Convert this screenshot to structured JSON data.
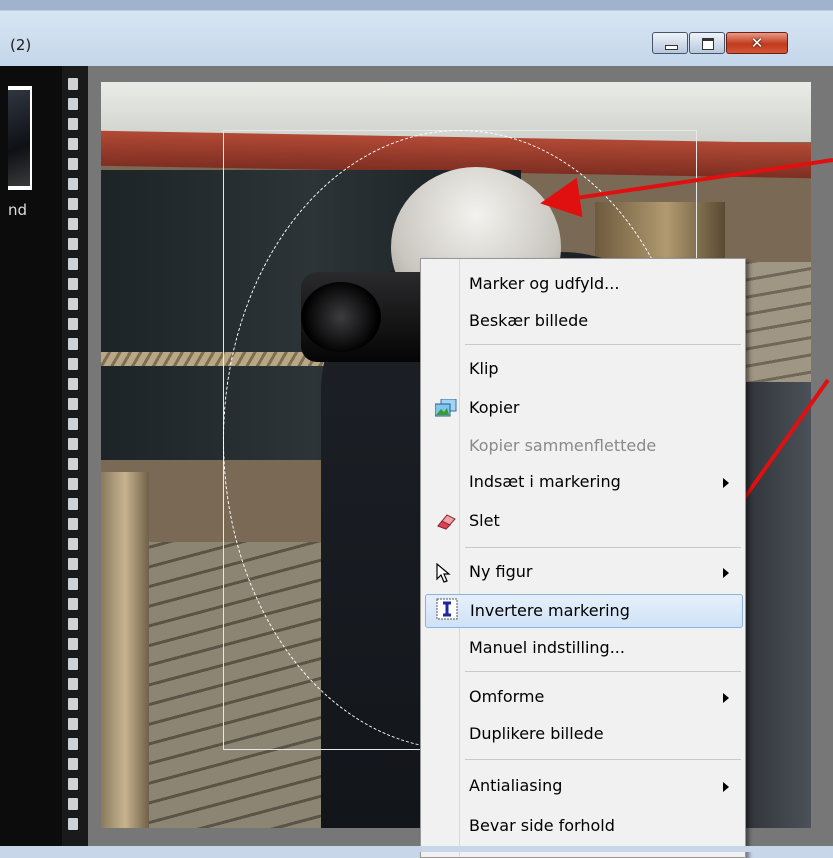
{
  "window": {
    "title": "(2)",
    "controls": {
      "minimize_icon": "minimize-icon",
      "maximize_icon": "maximize-icon",
      "close_icon": "close-icon",
      "close_glyph": "✕"
    }
  },
  "sidebar": {
    "thumb_label": "nd"
  },
  "context_menu": {
    "items": [
      {
        "label": "Marker og udfyld...",
        "enabled": true
      },
      {
        "label": "Beskær billede",
        "enabled": true
      },
      {
        "label": "Klip",
        "enabled": true
      },
      {
        "label": "Kopier",
        "enabled": true,
        "icon": "copy-image-icon"
      },
      {
        "label": "Kopier sammenflettede",
        "enabled": false
      },
      {
        "label": "Indsæt i markering",
        "enabled": true,
        "submenu": true
      },
      {
        "label": "Slet",
        "enabled": true,
        "icon": "eraser-icon"
      },
      {
        "label": "Ny figur",
        "enabled": true,
        "submenu": true,
        "icon": "pointer-icon"
      },
      {
        "label": "Invertere markering",
        "enabled": true,
        "highlighted": true,
        "icon": "text-cursor-icon"
      },
      {
        "label": "Manuel indstilling...",
        "enabled": true
      },
      {
        "label": "Omforme",
        "enabled": true,
        "submenu": true
      },
      {
        "label": "Duplikere billede",
        "enabled": true
      },
      {
        "label": "Antialiasing",
        "enabled": true,
        "submenu": true
      },
      {
        "label": "Bevar side forhold",
        "enabled": true
      }
    ]
  },
  "annotations": {
    "arrow_color": "#e01010"
  },
  "colors": {
    "menu_bg": "#f1f1f1",
    "highlight_border": "#8ab4e0",
    "disabled_text": "#8a8a8a"
  }
}
